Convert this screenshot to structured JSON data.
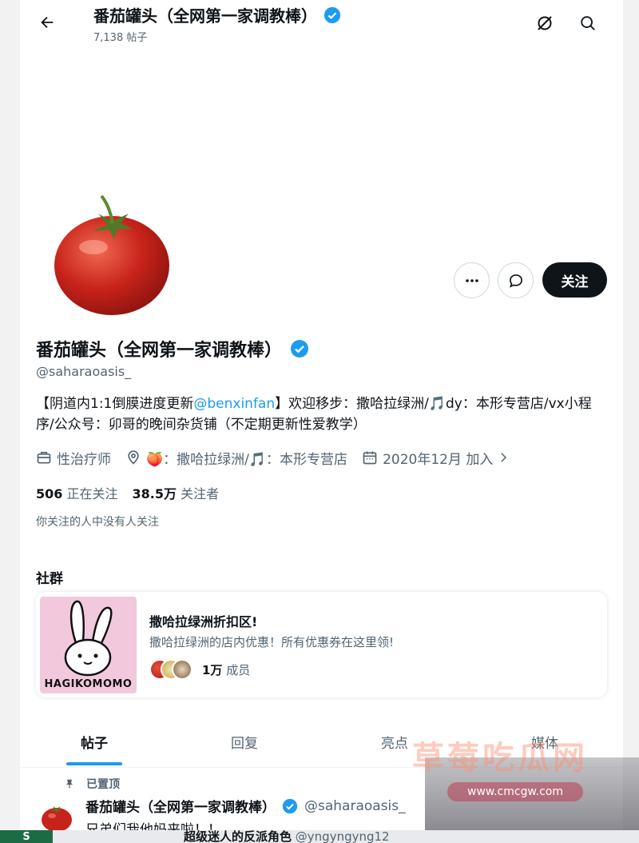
{
  "header": {
    "name": "番茄罐头（全网第一家调教棒）",
    "post_count": "7,138 帖子"
  },
  "profile": {
    "follow_label": "关注",
    "name": "番茄罐头（全网第一家调教棒）",
    "handle": "@saharaoasis_",
    "bio_part1": "【阴道内1:1倒膜进度更新",
    "bio_link": "@benxinfan",
    "bio_part2": "】欢迎移步：撒哈拉绿洲/🎵dy：本形专营店/vx小程序/公众号：卯哥的晚间杂货铺（不定期更新性爱教学）",
    "category": "性治疗师",
    "location": "🍑：撒哈拉绿洲/🎵：本形专营店",
    "joined": "2020年12月 加入",
    "following_count": "506",
    "following_label": "正在关注",
    "followers_count": "38.5万",
    "followers_label": "关注者",
    "followed_by": "你关注的人中没有人关注"
  },
  "community": {
    "section_title": "社群",
    "name": "撒哈拉绿洲折扣区!",
    "description": "撒哈拉绿洲的店内优惠！所有优惠券在这里领!",
    "members_count": "1万",
    "members_label": "成员",
    "logo_text": "HAGIKOMOMO"
  },
  "tabs": [
    {
      "label": "帖子",
      "active": true
    },
    {
      "label": "回复",
      "active": false
    },
    {
      "label": "亮点",
      "active": false
    },
    {
      "label": "媒体",
      "active": false
    }
  ],
  "pinned_post": {
    "pinned_label": "已置顶",
    "author": "番茄罐头（全网第一家调教棒）",
    "handle": "@saharaoasis_",
    "text": "兄弟们我他妈来啦！！"
  },
  "bottom_strip": {
    "chip": "S",
    "text": "超级迷人的反派角色",
    "handle": "@yngyngyng12"
  },
  "watermark": {
    "title": "草莓吃瓜网",
    "url": "www.cmcgw.com"
  },
  "colors": {
    "accent": "#1d9bf0",
    "follow_button": "#0f1419",
    "secondary_text": "#536471"
  }
}
